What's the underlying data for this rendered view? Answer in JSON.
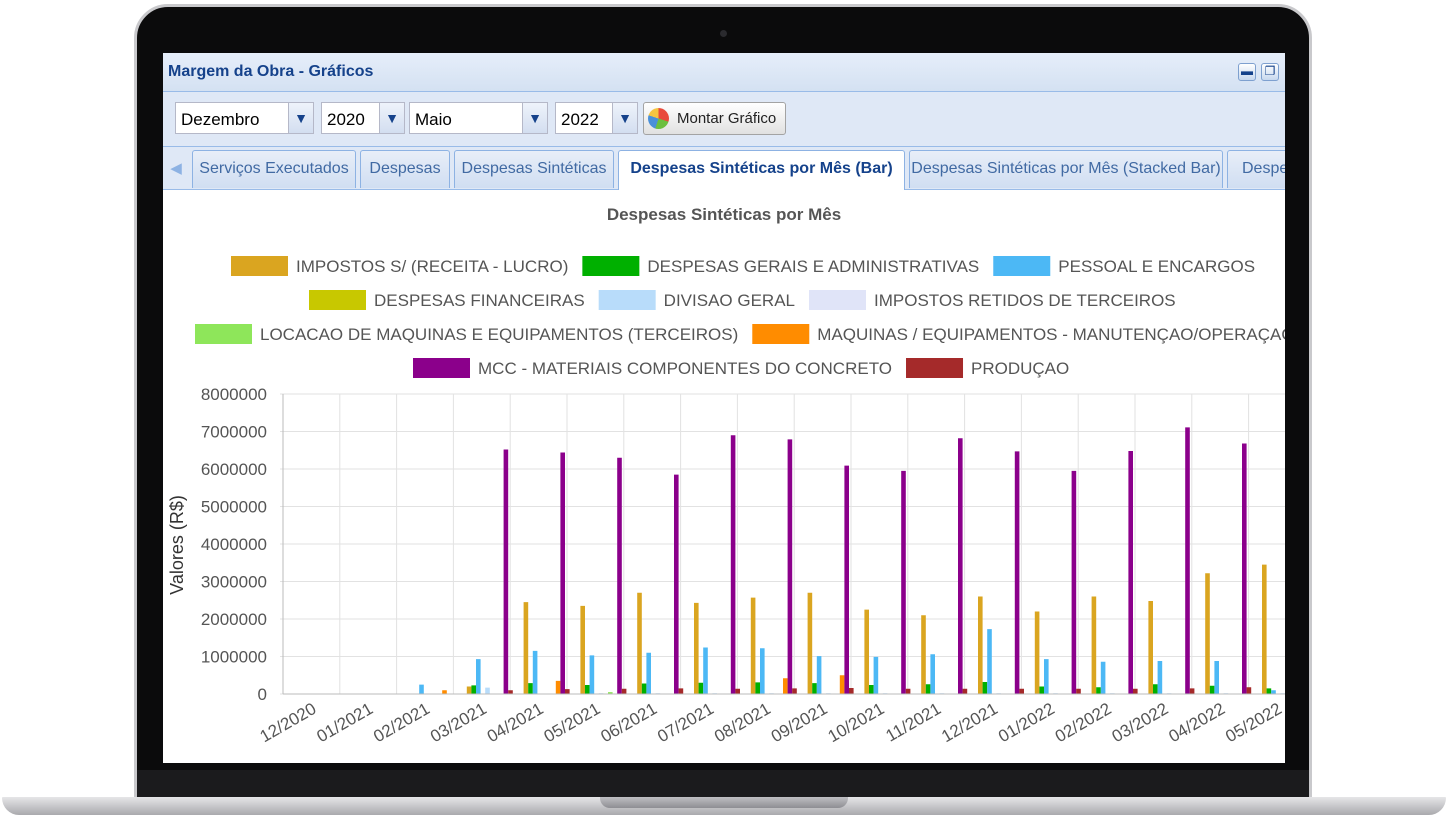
{
  "window": {
    "title": "Margem da Obra - Gráficos",
    "minimize_icon": "minimize-icon",
    "restore_icon": "restore-icon"
  },
  "toolbar": {
    "start_month": "Dezembro",
    "start_year": "2020",
    "end_month": "Maio",
    "end_year": "2022",
    "build_button": "Montar Gráfico",
    "build_icon": "pie-chart-icon"
  },
  "tabs": [
    {
      "label": "Serviços Executados"
    },
    {
      "label": "Despesas"
    },
    {
      "label": "Despesas Sintéticas"
    },
    {
      "label": "Despesas Sintéticas por Mês (Bar)",
      "active": true
    },
    {
      "label": "Despesas Sintéticas por Mês (Stacked Bar)"
    },
    {
      "label": "Despe"
    }
  ],
  "chart_data": {
    "type": "bar",
    "title": "Despesas Sintéticas por Mês",
    "ylabel": "Valores (R$)",
    "xlabel": "",
    "ylim": [
      0,
      8000000
    ],
    "yticks": [
      "0",
      "1000000",
      "2000000",
      "3000000",
      "4000000",
      "5000000",
      "6000000",
      "7000000",
      "8000000"
    ],
    "grid": true,
    "legend_position": "top",
    "categories": [
      "12/2020",
      "01/2021",
      "02/2021",
      "03/2021",
      "04/2021",
      "05/2021",
      "06/2021",
      "07/2021",
      "08/2021",
      "09/2021",
      "10/2021",
      "11/2021",
      "12/2021",
      "01/2022",
      "02/2022",
      "03/2022",
      "04/2022",
      "05/2022"
    ],
    "series": [
      {
        "name": "IMPOSTOS S/ (RECEITA - LUCRO)",
        "color": "#daa520",
        "values": [
          0,
          0,
          0,
          200000,
          2450000,
          2350000,
          2700000,
          2430000,
          2570000,
          2700000,
          2250000,
          2100000,
          2600000,
          2200000,
          2600000,
          2480000,
          3220000,
          3450000
        ]
      },
      {
        "name": "DESPESAS GERAIS E ADMINISTRATIVAS",
        "color": "#00b000",
        "values": [
          0,
          0,
          0,
          230000,
          290000,
          240000,
          280000,
          300000,
          310000,
          290000,
          240000,
          260000,
          320000,
          200000,
          180000,
          260000,
          220000,
          150000
        ]
      },
      {
        "name": "PESSOAL E ENCARGOS",
        "color": "#4cb8f5",
        "values": [
          0,
          0,
          250000,
          930000,
          1150000,
          1030000,
          1100000,
          1240000,
          1220000,
          1010000,
          990000,
          1060000,
          1730000,
          930000,
          860000,
          880000,
          880000,
          100000
        ]
      },
      {
        "name": "DESPESAS FINANCEIRAS",
        "color": "#c8c800",
        "values": [
          0,
          0,
          0,
          0,
          0,
          0,
          0,
          0,
          0,
          0,
          0,
          0,
          0,
          0,
          0,
          0,
          0,
          0
        ]
      },
      {
        "name": "DIVISAO GERAL",
        "color": "#b8dcfa",
        "values": [
          0,
          0,
          0,
          170000,
          0,
          20000,
          20000,
          20000,
          20000,
          20000,
          20000,
          20000,
          20000,
          20000,
          20000,
          20000,
          20000,
          20000
        ]
      },
      {
        "name": "IMPOSTOS RETIDOS DE TERCEIROS",
        "color": "#e0e4f8",
        "values": [
          0,
          0,
          0,
          0,
          0,
          0,
          0,
          0,
          0,
          0,
          0,
          0,
          0,
          0,
          0,
          0,
          0,
          0
        ]
      },
      {
        "name": "LOCACAO DE MAQUINAS E EQUIPAMENTOS (TERCEIROS)",
        "color": "#8ee65a",
        "values": [
          0,
          0,
          0,
          0,
          0,
          50000,
          0,
          0,
          0,
          0,
          0,
          0,
          0,
          0,
          0,
          0,
          0,
          0
        ]
      },
      {
        "name": "MAQUINAS / EQUIPAMENTOS - MANUTENÇAO/OPERAÇAO",
        "color": "#ff8c00",
        "values": [
          0,
          0,
          100000,
          0,
          350000,
          0,
          0,
          0,
          420000,
          500000,
          0,
          0,
          0,
          0,
          0,
          0,
          0,
          0
        ]
      },
      {
        "name": "MCC - MATERIAIS COMPONENTES DO CONCRETO",
        "color": "#8b008b",
        "values": [
          0,
          0,
          0,
          6520000,
          6440000,
          6300000,
          5850000,
          6900000,
          6790000,
          6090000,
          5950000,
          6820000,
          6470000,
          5950000,
          6480000,
          7110000,
          6680000,
          0
        ]
      },
      {
        "name": "PRODUÇAO",
        "color": "#a52a2a",
        "values": [
          0,
          0,
          0,
          100000,
          130000,
          140000,
          150000,
          140000,
          150000,
          160000,
          140000,
          140000,
          140000,
          140000,
          140000,
          150000,
          180000,
          200000
        ]
      }
    ]
  }
}
